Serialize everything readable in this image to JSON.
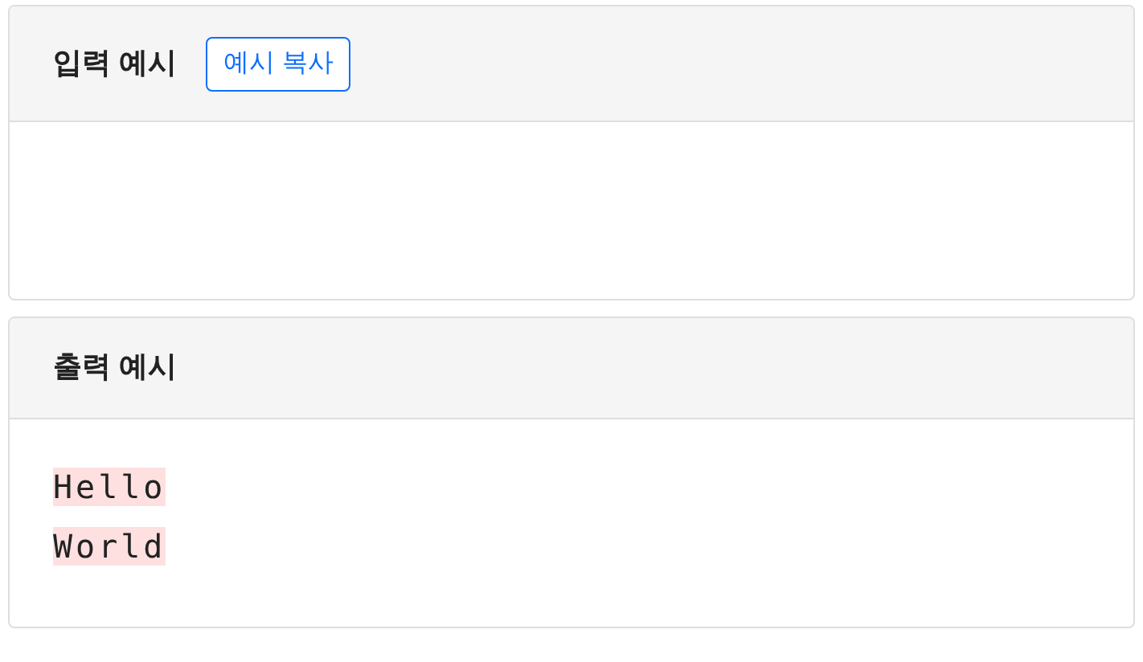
{
  "cards": [
    {
      "title": "입력 예시",
      "button": "예시 복사"
    },
    {
      "title": "출력 예시",
      "lines": [
        "Hello",
        "World"
      ]
    }
  ]
}
